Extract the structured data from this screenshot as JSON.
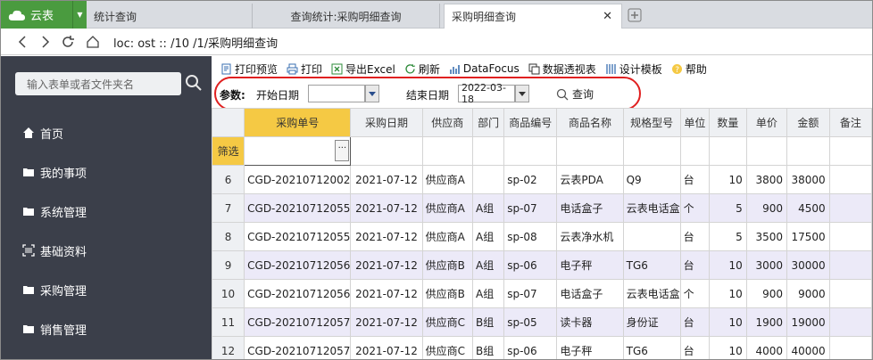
{
  "app": {
    "name": "云表"
  },
  "tabs": [
    {
      "label": "统计查询"
    },
    {
      "label": "查询统计:采购明细查询"
    },
    {
      "label": "采购明细查询"
    }
  ],
  "address": {
    "url": "loc: ost :: /10 /1/采购明细查询"
  },
  "sidebar": {
    "search_placeholder": "输入表单或者文件夹名",
    "items": [
      {
        "label": "首页",
        "icon": "home-icon"
      },
      {
        "label": "我的事项",
        "icon": "folder-icon"
      },
      {
        "label": "系统管理",
        "icon": "folder-icon"
      },
      {
        "label": "基础资料",
        "icon": "scan-icon"
      },
      {
        "label": "采购管理",
        "icon": "folder-icon"
      },
      {
        "label": "销售管理",
        "icon": "folder-icon"
      }
    ]
  },
  "toolbar": {
    "print_preview": "打印预览",
    "print": "打印",
    "export_excel": "导出Excel",
    "refresh": "刷新",
    "datafocus": "DataFocus",
    "pivot": "数据透视表",
    "design_template": "设计模板",
    "help": "帮助"
  },
  "params": {
    "title": "参数:",
    "start_label": "开始日期",
    "start_value": "",
    "end_label": "结束日期",
    "end_value": "2022-03-18",
    "query": "查询"
  },
  "grid": {
    "filter_label": "筛选",
    "columns": [
      "采购单号",
      "采购日期",
      "供应商",
      "部门",
      "商品编号",
      "商品名称",
      "规格型号",
      "单位",
      "数量",
      "单价",
      "金额",
      "备注"
    ],
    "rows": [
      {
        "n": "6",
        "cells": [
          "CGD-20210712002",
          "2021-07-12",
          "供应商A",
          "",
          "sp-02",
          "云表PDA",
          "Q9",
          "台",
          "10",
          "3800",
          "38000",
          ""
        ]
      },
      {
        "n": "7",
        "cells": [
          "CGD-20210712055",
          "2021-07-12",
          "供应商A",
          "A组",
          "sp-07",
          "电话盒子",
          "云表电话盒",
          "个",
          "5",
          "900",
          "4500",
          ""
        ]
      },
      {
        "n": "8",
        "cells": [
          "CGD-20210712055",
          "2021-07-12",
          "供应商A",
          "A组",
          "sp-08",
          "云表净水机",
          "",
          "台",
          "5",
          "3500",
          "17500",
          ""
        ]
      },
      {
        "n": "9",
        "cells": [
          "CGD-20210712056",
          "2021-07-12",
          "供应商B",
          "A组",
          "sp-06",
          "电子秤",
          "TG6",
          "台",
          "10",
          "3000",
          "30000",
          ""
        ]
      },
      {
        "n": "10",
        "cells": [
          "CGD-20210712056",
          "2021-07-12",
          "供应商B",
          "A组",
          "sp-07",
          "电话盒子",
          "云表电话盒",
          "个",
          "10",
          "900",
          "9000",
          ""
        ]
      },
      {
        "n": "11",
        "cells": [
          "CGD-20210712057",
          "2021-07-12",
          "供应商C",
          "B组",
          "sp-05",
          "读卡器",
          "身份证",
          "台",
          "10",
          "1900",
          "19000",
          ""
        ]
      },
      {
        "n": "12",
        "cells": [
          "CGD-20210712057",
          "2021-07-12",
          "供应商C",
          "B组",
          "sp-06",
          "电子秤",
          "TG6",
          "台",
          "10",
          "4000",
          "40000",
          ""
        ]
      }
    ]
  },
  "colors": {
    "accent_green": "#4a9b3f",
    "sidebar_bg": "#3b3f4a",
    "header_highlight": "#f5c944",
    "alt_row": "#eceaf8",
    "annotation_red": "#e02020"
  }
}
